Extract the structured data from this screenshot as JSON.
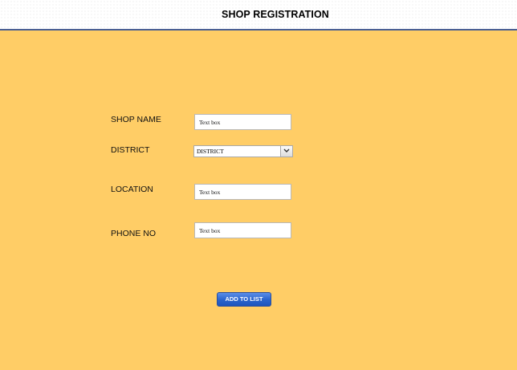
{
  "header": {
    "title": "SHOP REGISTRATION"
  },
  "form": {
    "shop_name": {
      "label": "SHOP NAME",
      "value": "Text box"
    },
    "district": {
      "label": "DISTRICT",
      "selected": "DISTRICT"
    },
    "location": {
      "label": "LOCATION",
      "value": "Text box"
    },
    "phone": {
      "label": "PHONE NO",
      "value": "Text box"
    }
  },
  "actions": {
    "add_label": "ADD TO LIST"
  },
  "icons": {
    "dropdown": "chevron-down-icon"
  },
  "colors": {
    "background": "#ffcd66",
    "header_border": "#4a5f93",
    "button": "#2a63cc"
  }
}
